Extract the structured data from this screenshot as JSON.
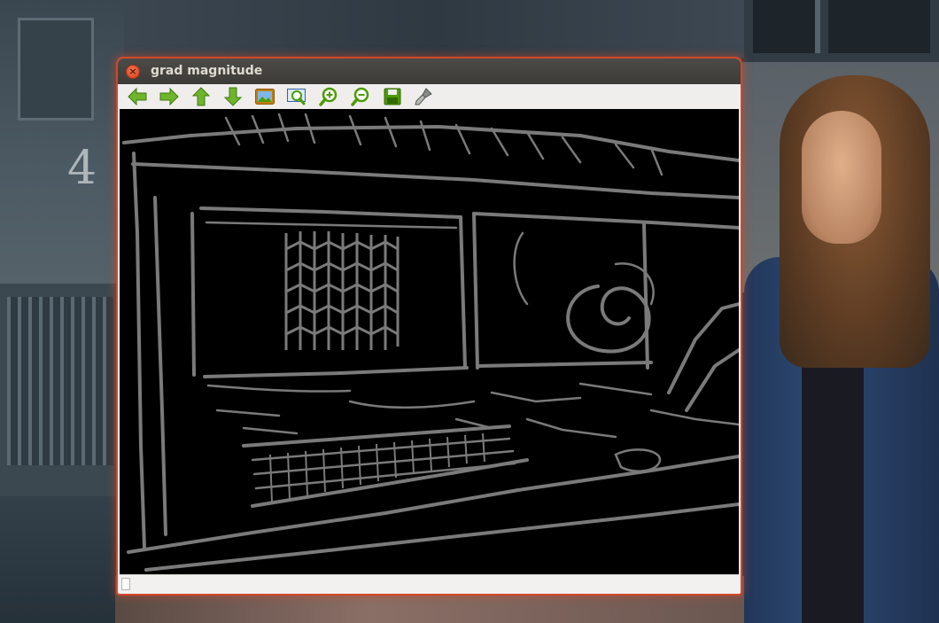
{
  "window": {
    "title": "grad magnitude",
    "close_icon_glyph": "×"
  },
  "toolbar": {
    "buttons": [
      {
        "name": "arrow-left-icon",
        "color": "#4e9a06"
      },
      {
        "name": "arrow-right-icon",
        "color": "#4e9a06"
      },
      {
        "name": "arrow-up-icon",
        "color": "#4e9a06"
      },
      {
        "name": "arrow-down-icon",
        "color": "#4e9a06"
      },
      {
        "name": "image-icon",
        "color": "#c4a000"
      },
      {
        "name": "zoom-fit-icon",
        "color": "#3465a4"
      },
      {
        "name": "zoom-in-icon",
        "color": "#4e9a06"
      },
      {
        "name": "zoom-out-icon",
        "color": "#4e9a06"
      },
      {
        "name": "save-icon",
        "color": "#4e9a06"
      },
      {
        "name": "brush-icon",
        "color": "#888a85"
      }
    ]
  },
  "image_view": {
    "content": "edge-detection gradient magnitude image",
    "edge_color": "#7a7a7a",
    "background_color": "#000000"
  },
  "wallpaper": {
    "house_number": "4"
  },
  "colors": {
    "titlebar": "#3c3b37",
    "title_text": "#dfdbd2",
    "window_focus_glow": "#d2482a",
    "toolbar_bg": "#efeeec"
  }
}
